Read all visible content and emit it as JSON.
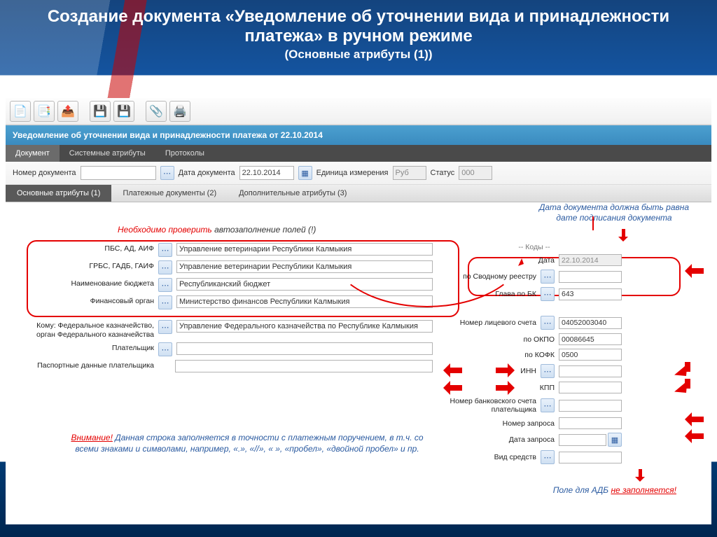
{
  "title": "Создание документа «Уведомление об уточнении вида и принадлежности платежа» в ручном режиме",
  "subtitle": "(Основные атрибуты (1))",
  "banner": "Уведомление об уточнении вида и принадлежности платежа от 22.10.2014",
  "tabs": [
    "Документ",
    "Системные атрибуты",
    "Протоколы"
  ],
  "row1": {
    "doc_no_label": "Номер документа",
    "doc_no_value": "",
    "doc_date_label": "Дата документа",
    "doc_date_value": "22.10.2014",
    "unit_label": "Единица измерения",
    "unit_value": "Руб",
    "status_label": "Статус",
    "status_value": "000"
  },
  "subtabs": [
    "Основные атрибуты (1)",
    "Платежные документы (2)",
    "Дополнительные атрибуты (3)"
  ],
  "left": {
    "pbs_label": "ПБС, АД, АИФ",
    "pbs_val": "Управление ветеринарии Республики Калмыкия",
    "grbs_label": "ГРБС, ГАДБ, ГАИФ",
    "grbs_val": "Управление ветеринарии Республики Калмыкия",
    "budget_label": "Наименование бюджета",
    "budget_val": "Республиканский бюджет",
    "fin_label": "Финансовый орган",
    "fin_val": "Министерство финансов Республики Калмыкия",
    "komu_label": "Кому: Федеральное казначейство,\nорган Федерального казначейства",
    "komu_val": "Управление Федерального казначейства по Республике Калмыкия",
    "payer_label": "Плательщик",
    "payer_val": "",
    "pass_label": "Паспортные данные плательщика",
    "pass_val": ""
  },
  "right": {
    "codes_hdr": "-- Коды --",
    "date_label": "Дата",
    "date_val": "22.10.2014",
    "svod_label": "по Сводному реестру",
    "svod_val": "",
    "glava_label": "Глава по БК",
    "glava_val": "643",
    "lic_label": "Номер лицевого счета",
    "lic_val": "04052003040",
    "okpo_label": "по ОКПО",
    "okpo_val": "00086645",
    "kofk_label": "по КОФК",
    "kofk_val": "0500",
    "inn_label": "ИНН",
    "kpp_label": "КПП",
    "bank_label": "Номер банковского счета плательщика",
    "req_label": "Номер запроса",
    "reqdate_label": "Дата запроса",
    "vids_label": "Вид средств"
  },
  "notes": {
    "autofill_red": "Необходимо проверить ",
    "autofill_black": "автозаполнение полей (!)",
    "top_right": "Дата документа должна быть равна дате подписания документа",
    "bottom_vn": "Внимание!",
    "bottom_text": " Данная строка заполняется в точности с платежным поручением, в т.ч. со всеми знаками и символами, например, «.», «//», « », «пробел», «двойной пробел» и пр.",
    "adb_pref": "Поле для АДБ ",
    "adb_ul": "не заполняется!"
  }
}
